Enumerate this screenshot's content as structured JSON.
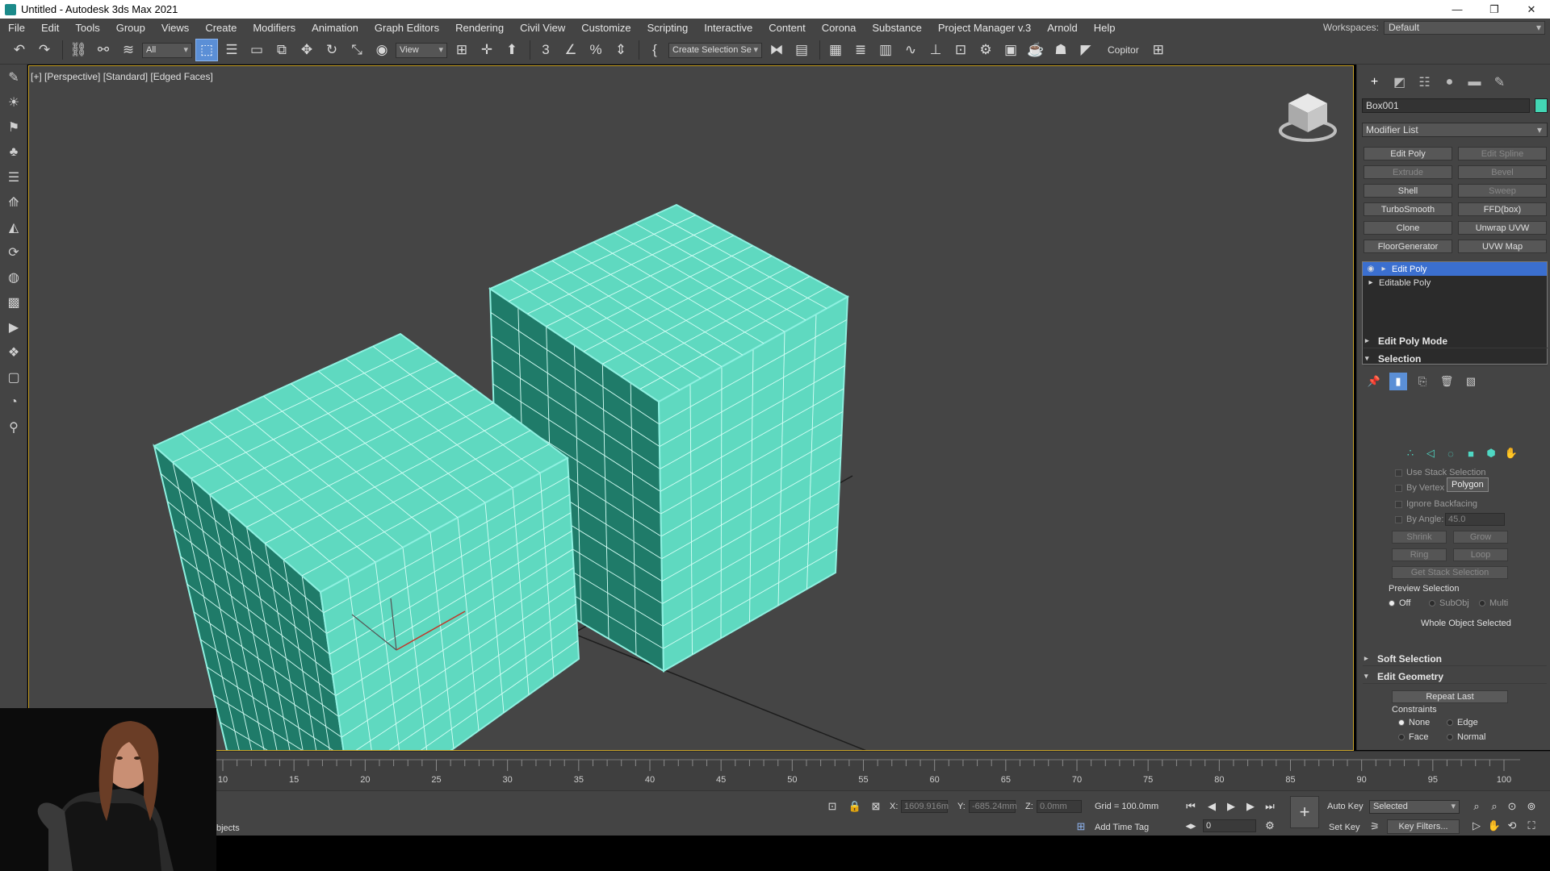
{
  "window": {
    "title": "Untitled - Autodesk 3ds Max 2021",
    "controls": [
      "—",
      "❐",
      "✕"
    ]
  },
  "menubar": {
    "items": [
      "File",
      "Edit",
      "Tools",
      "Group",
      "Views",
      "Create",
      "Modifiers",
      "Animation",
      "Graph Editors",
      "Rendering",
      "Civil View",
      "Customize",
      "Scripting",
      "Interactive",
      "Content",
      "Corona",
      "Substance",
      "Project Manager v.3",
      "Arnold",
      "Help"
    ],
    "workspaces_label": "Workspaces:",
    "workspaces_value": "Default"
  },
  "toolbar": {
    "filter_value": "All",
    "view_value": "View",
    "selection_set_placeholder": "Create Selection Se",
    "copitor_label": "Copitor"
  },
  "viewport": {
    "label": "[+] [Perspective] [Standard] [Edged Faces]",
    "object_color": "#5fd9c0",
    "background": "#454545"
  },
  "command_panel": {
    "object_name": "Box001",
    "object_color": "#43d6b4",
    "modifier_list": "Modifier List",
    "modifier_buttons": [
      {
        "label": "Edit Poly",
        "enabled": true
      },
      {
        "label": "Edit Spline",
        "enabled": false
      },
      {
        "label": "Extrude",
        "enabled": false
      },
      {
        "label": "Bevel",
        "enabled": false
      },
      {
        "label": "Shell",
        "enabled": true
      },
      {
        "label": "Sweep",
        "enabled": false
      },
      {
        "label": "TurboSmooth",
        "enabled": true
      },
      {
        "label": "FFD(box)",
        "enabled": true
      },
      {
        "label": "Clone",
        "enabled": true
      },
      {
        "label": "Unwrap UVW",
        "enabled": true
      },
      {
        "label": "FloorGenerator",
        "enabled": true
      },
      {
        "label": "UVW Map",
        "enabled": true
      }
    ],
    "stack": [
      {
        "label": "Edit Poly",
        "selected": true
      },
      {
        "label": "Editable Poly",
        "selected": false
      }
    ],
    "rollouts": {
      "edit_poly_mode": "Edit Poly Mode",
      "selection": "Selection",
      "soft_selection": "Soft Selection",
      "edit_geometry": "Edit Geometry"
    },
    "selection": {
      "use_stack_selection": "Use Stack Selection",
      "by_vertex": "By Vertex",
      "ignore_backfacing": "Ignore Backfacing",
      "by_angle": "By Angle:",
      "by_angle_value": "45.0",
      "shrink": "Shrink",
      "grow": "Grow",
      "ring": "Ring",
      "loop": "Loop",
      "get_stack_selection": "Get Stack Selection",
      "preview_selection": "Preview Selection",
      "preview_off": "Off",
      "preview_subobj": "SubObj",
      "preview_multi": "Multi",
      "status": "Whole Object Selected",
      "tooltip": "Polygon"
    },
    "edit_geometry": {
      "repeat_last": "Repeat Last",
      "constraints": "Constraints",
      "none": "None",
      "edge": "Edge",
      "face": "Face",
      "normal": "Normal"
    }
  },
  "timeline": {
    "ticks": [
      "10",
      "15",
      "20",
      "25",
      "30",
      "35",
      "40",
      "45",
      "50",
      "55",
      "60",
      "65",
      "70",
      "75",
      "80",
      "85",
      "90",
      "95",
      "100"
    ]
  },
  "statusbar": {
    "objects_text": "bjects",
    "x_label": "X:",
    "x_value": "1609.916m",
    "y_label": "Y:",
    "y_value": "-685.24mm",
    "z_label": "Z:",
    "z_value": "0.0mm",
    "grid": "Grid = 100.0mm",
    "add_time_tag": "Add Time Tag",
    "auto_key": "Auto Key",
    "selected": "Selected",
    "set_key": "Set Key",
    "key_filters": "Key Filters...",
    "frame_value": "0"
  }
}
